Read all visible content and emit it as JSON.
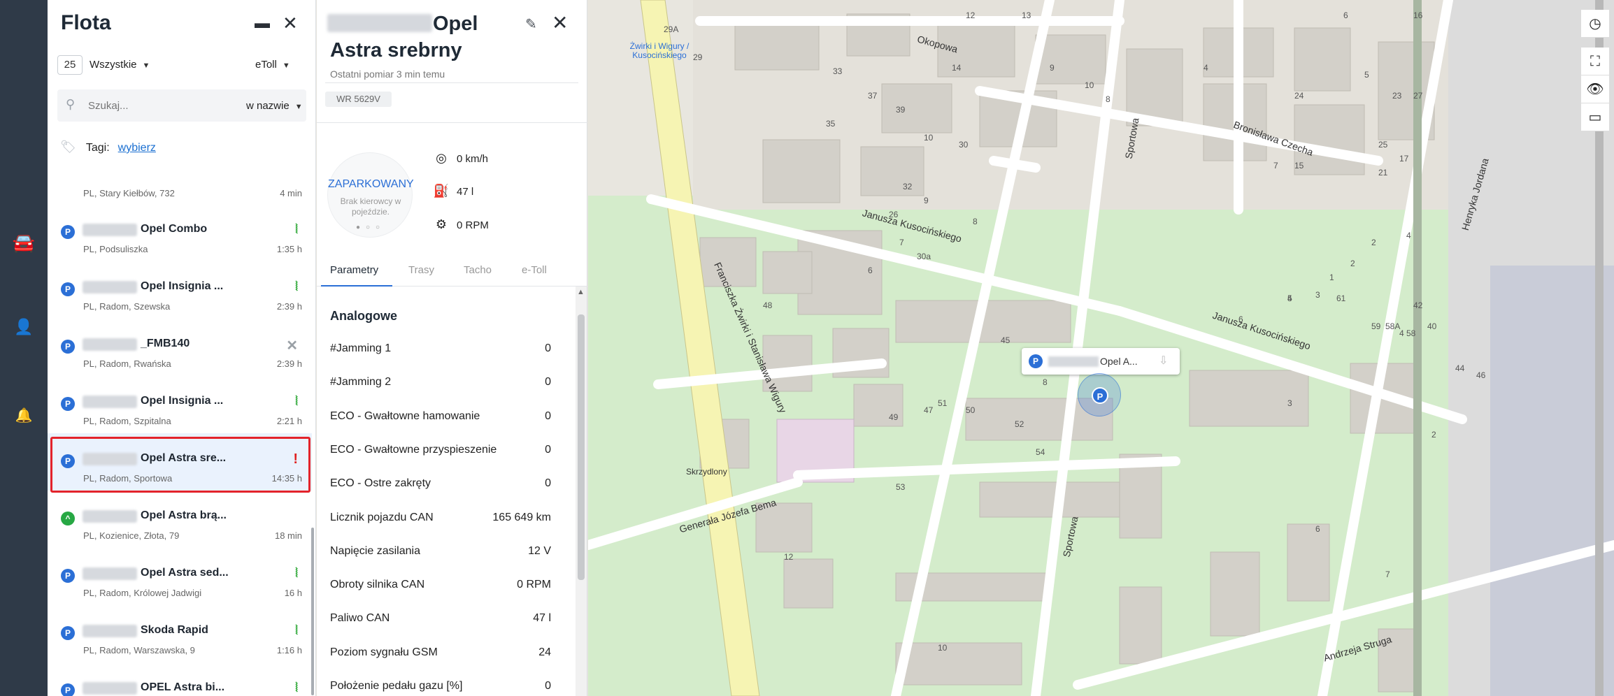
{
  "fleet": {
    "title": "Flota",
    "count": "25",
    "filter_all": "Wszystkie",
    "filter_etoll": "eToll",
    "search_placeholder": "Szukaj...",
    "search_mode": "w nazwie",
    "tags_label": "Tagi:",
    "tags_link": "wybierz",
    "vehicles": [
      {
        "name": "",
        "address": "PL, Stary Kiełbów, 732",
        "time": "4 min",
        "status": ""
      },
      {
        "name": "Opel Combo",
        "address": "PL, Podsuliszka",
        "time": "1:35 h",
        "status": "signal"
      },
      {
        "name": "Opel Insignia ...",
        "address": "PL, Radom, Szewska",
        "time": "2:39 h",
        "status": "signal"
      },
      {
        "name": "_FMB140",
        "address": "PL, Radom, Rwańska",
        "time": "2:39 h",
        "status": "none"
      },
      {
        "name": "Opel Insignia ...",
        "address": "PL, Radom, Szpitalna",
        "time": "2:21 h",
        "status": "signal"
      },
      {
        "name": "Opel Astra sre...",
        "address": "PL, Radom, Sportowa",
        "time": "14:35 h",
        "status": "alert"
      },
      {
        "name": "Opel Astra brą...",
        "address": "PL, Kozienice, Złota, 79",
        "time": "18 min",
        "status": ""
      },
      {
        "name": "Opel Astra sed...",
        "address": "PL, Radom, Królowej Jadwigi",
        "time": "16 h",
        "status": "signal"
      },
      {
        "name": "Skoda Rapid",
        "address": "PL, Radom, Warszawska, 9",
        "time": "1:16 h",
        "status": "signal"
      },
      {
        "name": "OPEL Astra bi...",
        "address": "",
        "time": "",
        "status": "signal"
      }
    ]
  },
  "detail": {
    "title_line1": "Opel",
    "title_line2": "Astra srebrny",
    "last_measure": "Ostatni pomiar 3 min temu",
    "plate": "WR 5629V",
    "status_main": "ZAPARKOWANY",
    "status_sub": "Brak kierowcy w pojeździe.",
    "speed": "0 km/h",
    "fuel": "47 l",
    "rpm": "0 RPM",
    "tabs": [
      "Parametry",
      "Trasy",
      "Tacho",
      "e-Toll"
    ],
    "params_title": "Analogowe",
    "params": [
      {
        "label": "#Jamming 1",
        "value": "0"
      },
      {
        "label": "#Jamming 2",
        "value": "0"
      },
      {
        "label": "ECO - Gwałtowne hamowanie",
        "value": "0"
      },
      {
        "label": "ECO - Gwałtowne przyspieszenie",
        "value": "0"
      },
      {
        "label": "ECO - Ostre zakręty",
        "value": "0"
      },
      {
        "label": "Licznik pojazdu CAN",
        "value": "165 649 km"
      },
      {
        "label": "Napięcie zasilania",
        "value": "12 V"
      },
      {
        "label": "Obroty silnika CAN",
        "value": "0 RPM"
      },
      {
        "label": "Paliwo CAN",
        "value": "47 l"
      },
      {
        "label": "Poziom sygnału GSM",
        "value": "24"
      },
      {
        "label": "Położenie pedału gazu [%]",
        "value": "0"
      }
    ]
  },
  "map": {
    "popup_name": "Opel A...",
    "marker_letter": "P",
    "streets": {
      "okopowa": "Okopowa",
      "czecha": "Bronisława Czecha",
      "kusocinskiego1": "Janusza Kusocińskiego",
      "kusocinskiego2": "Janusza Kusocińskiego",
      "wigury": "Franciszka Żwirki i Stanisława Wigury",
      "bema": "Generała Józefa Bema",
      "sportowa1": "Sportowa",
      "sportowa2": "Sportowa",
      "jordana": "Henryka Jordana",
      "struga": "Andrzeja Struga"
    },
    "pois": {
      "kusocinskiego_stop": "Żwirki i Wigury / Kusocińskiego",
      "skrzydlony": "Skrzydlony"
    },
    "house_numbers": [
      "12",
      "13",
      "6",
      "16",
      "9",
      "5",
      "14",
      "10",
      "8",
      "4",
      "21",
      "23",
      "24",
      "25",
      "27",
      "17",
      "15",
      "7",
      "29",
      "29A",
      "33",
      "35",
      "37",
      "39",
      "10",
      "30",
      "32",
      "26",
      "8",
      "30a",
      "9",
      "7",
      "6",
      "2",
      "4",
      "6",
      "5",
      "4",
      "3",
      "2",
      "1",
      "3",
      "61",
      "59",
      "58A",
      "58",
      "40",
      "42",
      "44",
      "46",
      "48",
      "50",
      "52",
      "54",
      "45",
      "47",
      "49",
      "51",
      "53",
      "12",
      "10",
      "8",
      "6",
      "4",
      "2",
      "7"
    ]
  },
  "colors": {
    "accent": "#2b6fd6",
    "alert": "#e3232b",
    "signal": "#2fa838",
    "rail": "#2f3a48"
  }
}
